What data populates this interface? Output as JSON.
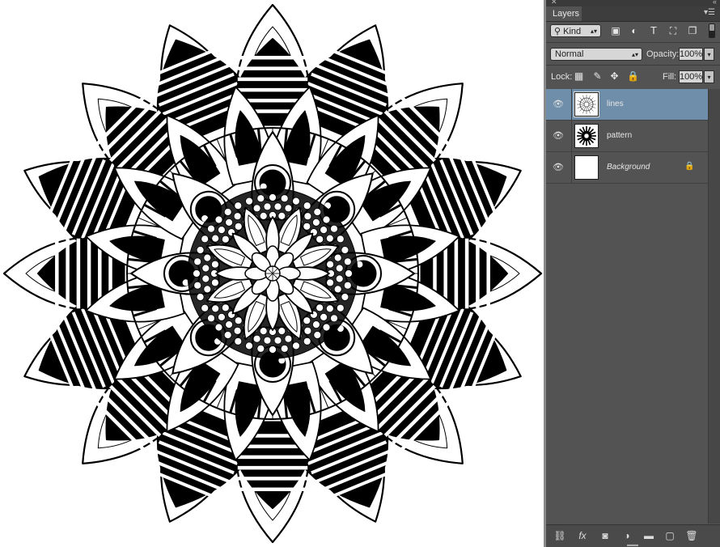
{
  "panel": {
    "tab_label": "Layers",
    "filter": {
      "kind_label": "Kind",
      "icons": [
        "image-filter-icon",
        "adjustment-filter-icon",
        "type-filter-icon",
        "shape-filter-icon",
        "smart-object-filter-icon"
      ]
    },
    "blend_mode": "Normal",
    "opacity_label": "Opacity:",
    "opacity_value": "100%",
    "lock_label": "Lock:",
    "fill_label": "Fill:",
    "fill_value": "100%"
  },
  "layers": [
    {
      "name": "lines",
      "selected": true,
      "visible": true,
      "locked": false,
      "italic": false
    },
    {
      "name": "pattern",
      "selected": false,
      "visible": true,
      "locked": false,
      "italic": false
    },
    {
      "name": "Background",
      "selected": false,
      "visible": true,
      "locked": true,
      "italic": true
    }
  ],
  "bottom_bar": [
    "link-layers-icon",
    "fx-icon",
    "add-mask-icon",
    "adjustment-layer-icon",
    "group-folder-icon",
    "new-layer-icon",
    "trash-icon"
  ],
  "colors": {
    "panel_bg": "#535353",
    "selected_layer": "#6f8ea9",
    "canvas_bg": "#ffffff",
    "ink": "#000000"
  }
}
